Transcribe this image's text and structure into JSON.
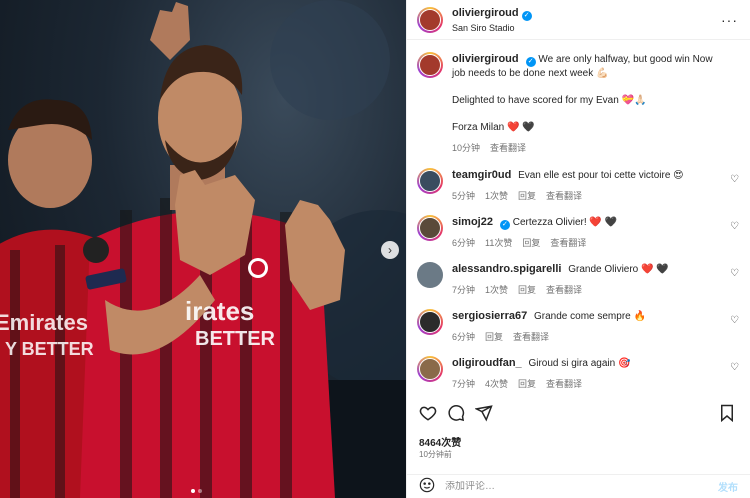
{
  "header": {
    "username": "oliviergiroud",
    "location": "San Siro Stadio",
    "more_icon": "more-horizontal-icon"
  },
  "caption": {
    "username": "oliviergiroud",
    "line1": "We are only halfway, but good win Now job needs to be done next week 💪🏻",
    "line2": "Delighted to have scored for my Evan 💝🙏🏻",
    "line3": "Forza Milan ❤️ 🖤",
    "time": "10分钟",
    "translate": "查看翻译"
  },
  "comments": [
    {
      "username": "teamgir0ud",
      "text": "Evan elle est pour toi cette victoire 😍",
      "time": "5分钟",
      "likes": "1次赞",
      "reply": "回复",
      "translate": "查看翻译"
    },
    {
      "username": "simoj22",
      "verified": true,
      "text": "Certezza Olivier! ❤️ 🖤",
      "time": "6分钟",
      "likes": "11次赞",
      "reply": "回复",
      "translate": "查看翻译"
    },
    {
      "username": "alessandro.spigarelli",
      "text": "Grande Oliviero ❤️ 🖤",
      "time": "7分钟",
      "likes": "1次赞",
      "reply": "回复",
      "translate": "查看翻译"
    },
    {
      "username": "sergiosierra67",
      "text": "Grande come sempre 🔥",
      "time": "6分钟",
      "reply": "回复",
      "translate": "查看翻译"
    },
    {
      "username": "oligiroudfan_",
      "text": "Giroud si gira again 🎯",
      "time": "7分钟",
      "likes": "4次赞",
      "reply": "回复",
      "translate": "查看翻译"
    }
  ],
  "actions": {
    "like_icon": "heart-icon",
    "comment_icon": "comment-icon",
    "share_icon": "share-icon",
    "save_icon": "bookmark-icon"
  },
  "likes_count": "8464次赞",
  "post_time": "10分钟前",
  "composer": {
    "placeholder": "添加评论…",
    "post_label": "发布",
    "emoji_icon": "emoji-icon"
  },
  "colors": {
    "accent_blue": "#0095f6",
    "heart_red": "#e0245e",
    "milan_red": "#c8102e"
  }
}
